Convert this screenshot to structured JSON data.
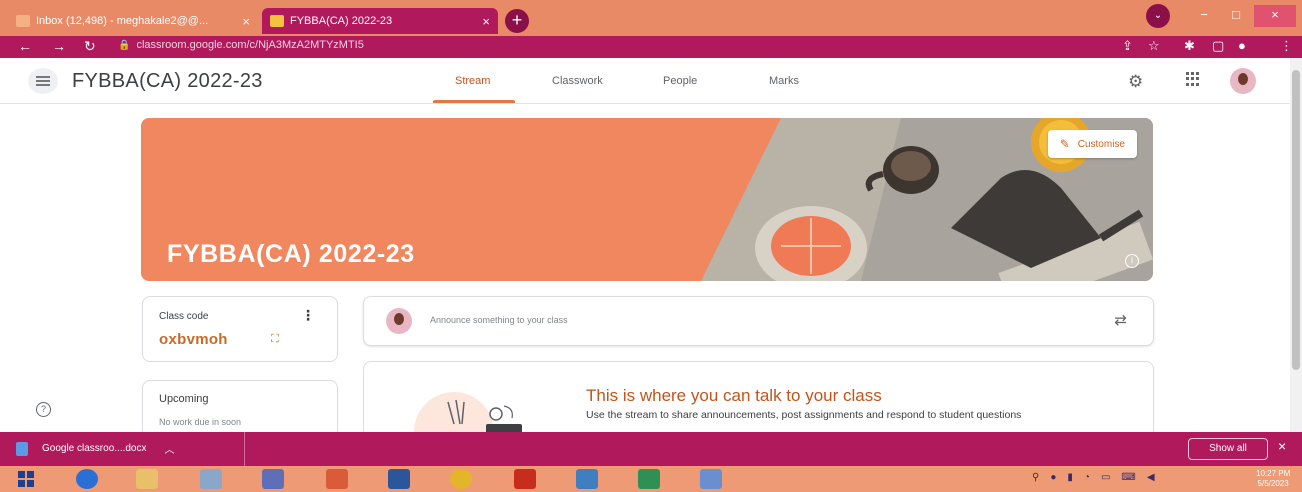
{
  "browser": {
    "tabs": [
      {
        "title": "Inbox (12,498) - meghakale2@@...",
        "close": "×"
      },
      {
        "title": "FYBBA(CA) 2022-23",
        "close": "×"
      }
    ],
    "new_tab": "+",
    "url": "classroom.google.com/c/NjA3MzA2MTYzMTI5",
    "window_controls": {
      "minimize": "−",
      "maximize": "□",
      "close": "×"
    }
  },
  "header": {
    "class_title": "FYBBA(CA) 2022-23",
    "tabs": [
      {
        "label": "Stream"
      },
      {
        "label": "Classwork"
      },
      {
        "label": "People"
      },
      {
        "label": "Marks"
      }
    ]
  },
  "banner": {
    "title": "FYBBA(CA) 2022-23",
    "customise_label": "Customise",
    "color": "#f1875f"
  },
  "class_code": {
    "label": "Class code",
    "value": "oxbvmoh"
  },
  "upcoming": {
    "label": "Upcoming",
    "subtext": "No work due in soon"
  },
  "announce": {
    "placeholder": "Announce something to your class"
  },
  "talk": {
    "title": "This is where you can talk to your class",
    "description": "Use the stream to share announcements, post assignments and respond to student questions"
  },
  "downloads": {
    "file_name": "Google classroo....docx",
    "show_all": "Show all",
    "close": "×"
  },
  "taskbar": {
    "time": "10:27 PM",
    "date": "5/5/2023"
  },
  "colors": {
    "accent": "#c2541c",
    "browser_frame": "#b0195c",
    "tabstrip": "#e98a66"
  }
}
